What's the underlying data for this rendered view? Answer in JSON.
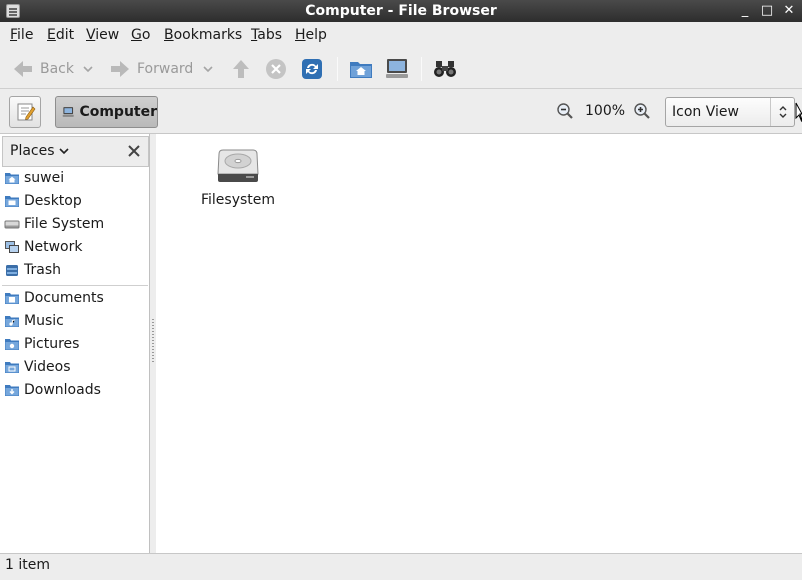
{
  "window": {
    "title": "Computer - File Browser",
    "minimize": "_",
    "maximize": "□",
    "close": "✕"
  },
  "menu": [
    {
      "label": "File",
      "mnemonic": "F",
      "rest": "ile"
    },
    {
      "label": "Edit",
      "mnemonic": "E",
      "rest": "dit"
    },
    {
      "label": "View",
      "mnemonic": "V",
      "rest": "iew"
    },
    {
      "label": "Go",
      "mnemonic": "G",
      "rest": "o"
    },
    {
      "label": "Bookmarks",
      "mnemonic": "B",
      "rest": "ookmarks"
    },
    {
      "label": "Tabs",
      "mnemonic": "T",
      "rest": "abs"
    },
    {
      "label": "Help",
      "mnemonic": "H",
      "rest": "elp"
    }
  ],
  "toolbar": {
    "back_label": "Back",
    "forward_label": "Forward",
    "icons": [
      "back-arrow-icon",
      "forward-arrow-icon",
      "up-arrow-icon",
      "stop-icon",
      "reload-icon",
      "home-folder-icon",
      "computer-icon",
      "search-binoculars-icon"
    ]
  },
  "location": {
    "breadcrumb_label": "Computer",
    "zoom": "100%",
    "view_mode": "Icon View"
  },
  "sidebar": {
    "header": "Places",
    "items": [
      {
        "label": "suwei",
        "icon": "home-folder-icon"
      },
      {
        "label": "Desktop",
        "icon": "desktop-folder-icon"
      },
      {
        "label": "File System",
        "icon": "drive-icon"
      },
      {
        "label": "Network",
        "icon": "network-icon"
      },
      {
        "label": "Trash",
        "icon": "trash-icon"
      }
    ],
    "bookmarks": [
      {
        "label": "Documents",
        "icon": "documents-folder-icon"
      },
      {
        "label": "Music",
        "icon": "music-folder-icon"
      },
      {
        "label": "Pictures",
        "icon": "pictures-folder-icon"
      },
      {
        "label": "Videos",
        "icon": "videos-folder-icon"
      },
      {
        "label": "Downloads",
        "icon": "downloads-folder-icon"
      }
    ]
  },
  "files": [
    {
      "label": "Filesystem",
      "icon": "hard-drive-icon"
    }
  ],
  "status": "1 item"
}
